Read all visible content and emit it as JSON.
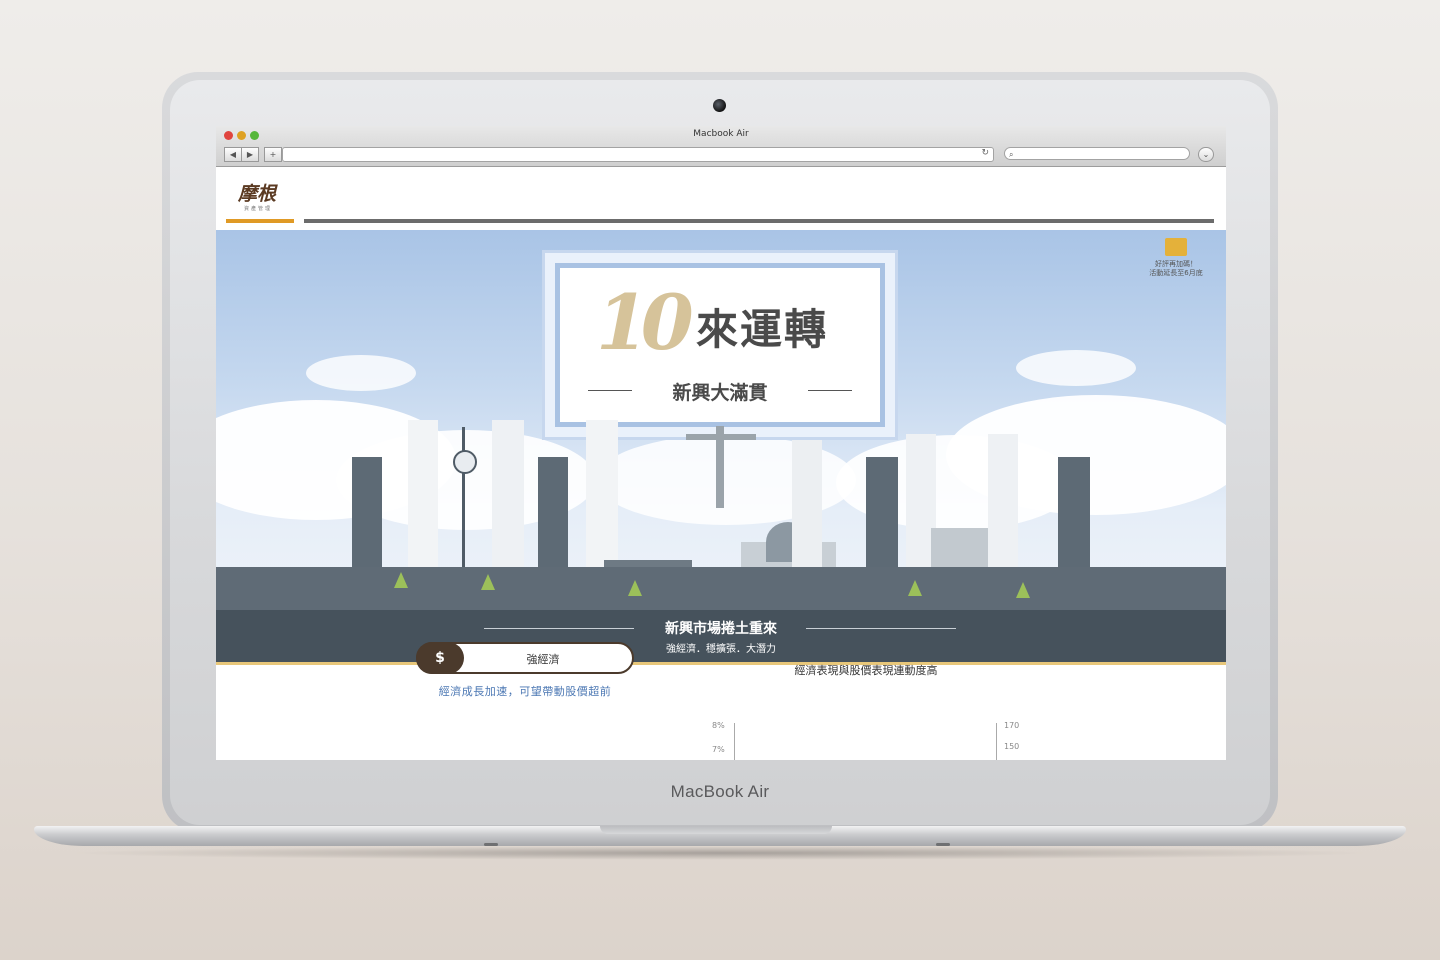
{
  "device": {
    "label": "MacBook Air"
  },
  "browser": {
    "window_title": "Macbook Air",
    "new_tab": "+"
  },
  "site": {
    "logo_text": "摩根",
    "logo_sub": "資產管理"
  },
  "hero": {
    "number_mark": "10",
    "headline": "來運轉",
    "subheadline": "新興大滿貫",
    "badge_line1": "好評再加碼！",
    "badge_line2": "活動延長至6月底",
    "band_title": "新興市場捲土重來",
    "band_subtitle": "強經濟．穩擴張．大潛力"
  },
  "section": {
    "pill_icon": "$",
    "pill_label": "強經濟",
    "pill_text": "經濟成長加速，可望帶動股價超前",
    "chart_title": "經濟表現與股價表現連動度高"
  },
  "chart_data": {
    "type": "line",
    "title": "經濟表現與股價表現連動度高",
    "left_ticks": [
      "8%",
      "7%"
    ],
    "right_ticks": [
      "170",
      "150"
    ]
  },
  "colors": {
    "accent": "#e09a25",
    "brand": "#5b3a22",
    "band": "#46525c"
  }
}
